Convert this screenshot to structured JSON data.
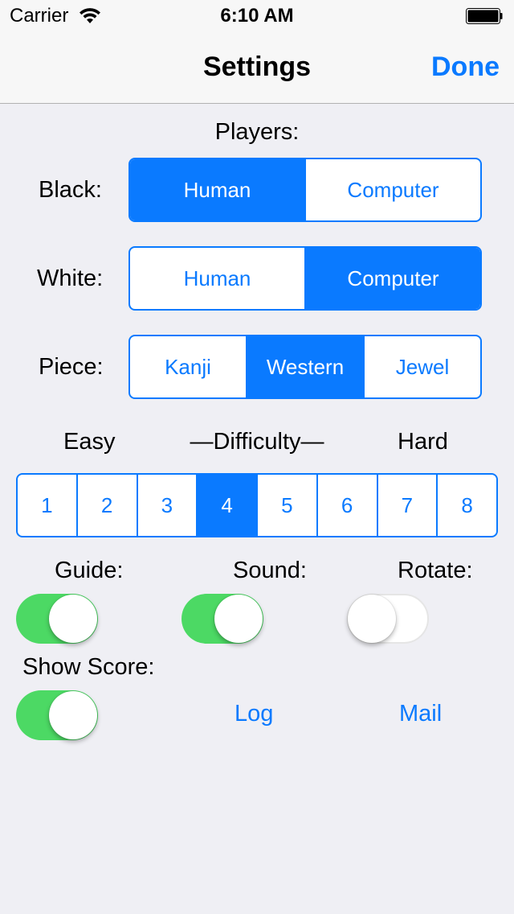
{
  "status_bar": {
    "carrier": "Carrier",
    "time": "6:10 AM"
  },
  "nav": {
    "title": "Settings",
    "done_label": "Done"
  },
  "players": {
    "heading": "Players:",
    "black": {
      "label": "Black:",
      "options": [
        "Human",
        "Computer"
      ],
      "selected": "Human"
    },
    "white": {
      "label": "White:",
      "options": [
        "Human",
        "Computer"
      ],
      "selected": "Computer"
    }
  },
  "piece": {
    "label": "Piece:",
    "options": [
      "Kanji",
      "Western",
      "Jewel"
    ],
    "selected": "Western"
  },
  "difficulty": {
    "easy_label": "Easy",
    "title": "—Difficulty—",
    "hard_label": "Hard",
    "levels": [
      "1",
      "2",
      "3",
      "4",
      "5",
      "6",
      "7",
      "8"
    ],
    "selected": "4"
  },
  "toggles": {
    "guide": {
      "label": "Guide:",
      "on": true
    },
    "sound": {
      "label": "Sound:",
      "on": true
    },
    "rotate": {
      "label": "Rotate:",
      "on": false
    },
    "show_score": {
      "label": "Show Score:",
      "on": true
    }
  },
  "links": {
    "log": "Log",
    "mail": "Mail"
  },
  "colors": {
    "accent": "#0a7aff",
    "toggle_on": "#4cd964",
    "background": "#efeff4"
  }
}
